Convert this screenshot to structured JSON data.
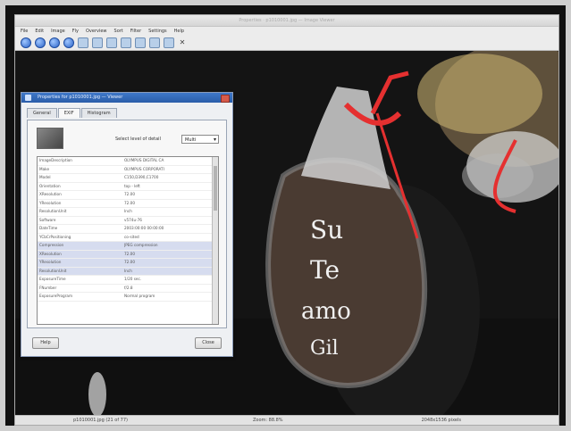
{
  "window": {
    "title": "Properties · p1010001.jpg — Image Viewer",
    "menu": [
      "File",
      "Edit",
      "Image",
      "Fly",
      "Overview",
      "Sort",
      "Filter",
      "Settings",
      "Help"
    ]
  },
  "toolbar": {
    "icons": [
      "back-icon",
      "forward-icon",
      "up-icon",
      "reload-icon",
      "image-icon",
      "paint-icon",
      "copy-icon",
      "zoom-in-icon",
      "zoom-out-icon",
      "fit-icon",
      "rotate-icon",
      "close-icon"
    ]
  },
  "status": {
    "file": "p1010001.jpg (21 of 77)",
    "zoom": "Zoom: 88.8%",
    "size": "2048x1536 pixels"
  },
  "dialog": {
    "title": "Properties for p1010001.jpg — Viewer",
    "tabs": [
      "General",
      "EXIF",
      "Histogram"
    ],
    "active_tab": "EXIF",
    "level_label": "Select level of detail",
    "level_value": "Multi",
    "rows": [
      {
        "k": "ImageDescription",
        "v": "OLYMPUS DIGITAL CA"
      },
      {
        "k": "Make",
        "v": "OLYMPUS CORPORATI"
      },
      {
        "k": "Model",
        "v": "C150,D390,C1700"
      },
      {
        "k": "Orientation",
        "v": "top - left"
      },
      {
        "k": "XResolution",
        "v": "72.00"
      },
      {
        "k": "YResolution",
        "v": "72.00"
      },
      {
        "k": "ResolutionUnit",
        "v": "Inch"
      },
      {
        "k": "Software",
        "v": "v574u-76"
      },
      {
        "k": "DateTime",
        "v": "2003:00:00 00:00:00"
      },
      {
        "k": "YCbCrPositioning",
        "v": "co-sited"
      },
      {
        "k": "Compression",
        "v": "JPEG compression"
      },
      {
        "k": "XResolution",
        "v": "72.00"
      },
      {
        "k": "YResolution",
        "v": "72.00"
      },
      {
        "k": "ResolutionUnit",
        "v": "Inch"
      },
      {
        "k": "ExposureTime",
        "v": "1/20 sec."
      },
      {
        "k": "FNumber",
        "v": "f/2.8"
      },
      {
        "k": "ExposureProgram",
        "v": "Normal program"
      }
    ],
    "buttons": {
      "help": "Help",
      "close": "Close"
    }
  }
}
